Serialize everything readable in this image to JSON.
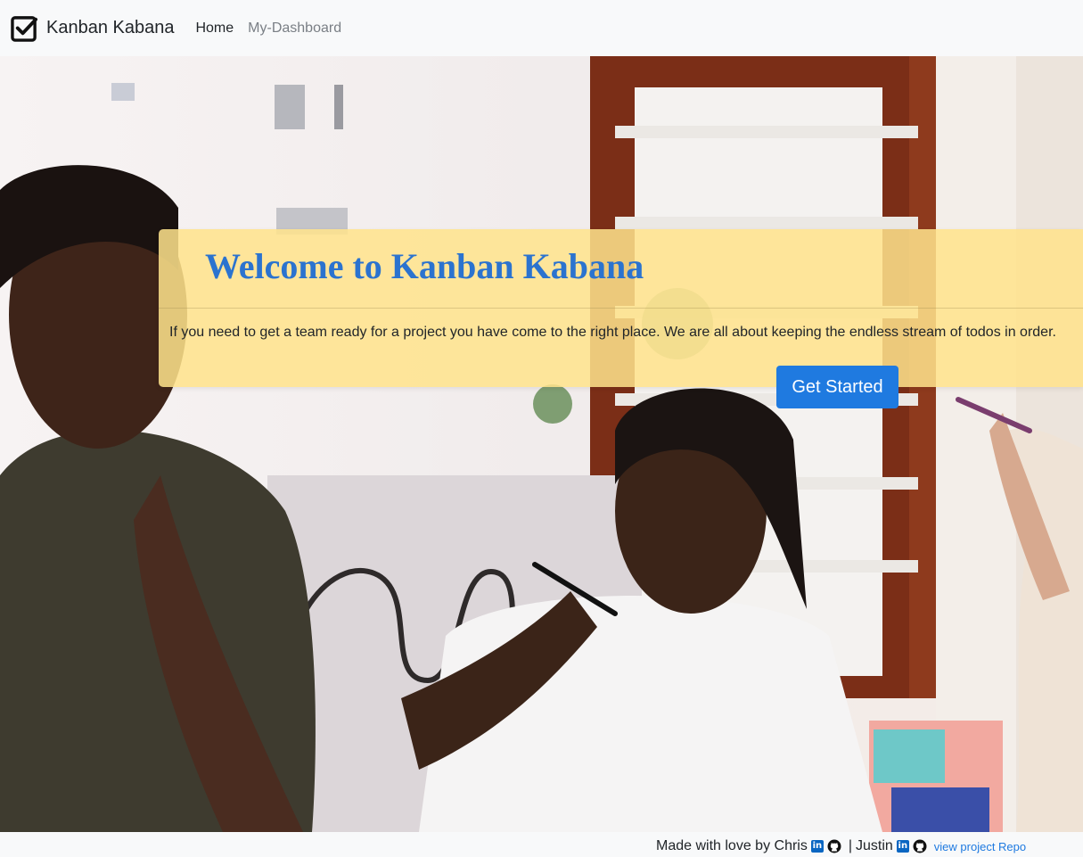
{
  "navbar": {
    "brand": "Kanban Kabana",
    "links": [
      "Home",
      "My-Dashboard"
    ]
  },
  "hero": {
    "title": "Welcome to Kanban Kabana",
    "text": "If you need to get a team ready for a project you have come to the right place. We are all about keeping the endless stream of todos in order.",
    "cta_label": "Get Started",
    "colors": {
      "title": "#2b73cf",
      "button": "#1f7ae0",
      "banner": "#ffe38c"
    }
  },
  "footer": {
    "made_by": "Made with love by Chris",
    "separator": "|",
    "second_author": "Justin",
    "repo_link": "view project Repo",
    "icons": [
      "linkedin-icon",
      "github-icon"
    ]
  }
}
